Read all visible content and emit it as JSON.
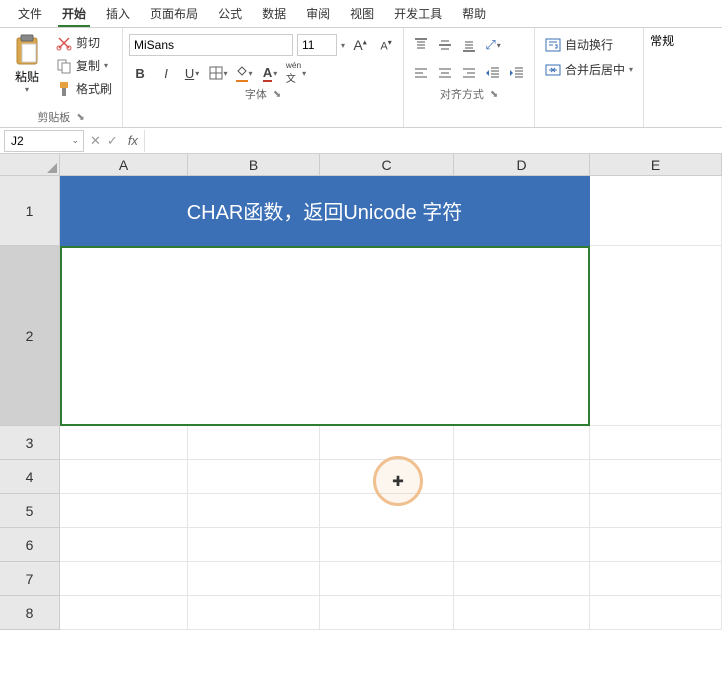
{
  "menu": {
    "items": [
      "文件",
      "开始",
      "插入",
      "页面布局",
      "公式",
      "数据",
      "审阅",
      "视图",
      "开发工具",
      "帮助"
    ],
    "active_index": 1
  },
  "ribbon": {
    "clipboard": {
      "paste": "粘贴",
      "cut": "剪切",
      "copy": "复制",
      "format_painter": "格式刷",
      "group_label": "剪贴板"
    },
    "font": {
      "font_name": "MiSans",
      "font_size": "11",
      "group_label": "字体",
      "bold": "B",
      "italic": "I",
      "underline": "U",
      "wen": "文"
    },
    "align": {
      "group_label": "对齐方式"
    },
    "merge": {
      "wrap_text": "自动换行",
      "merge_center": "合并后居中"
    },
    "right": {
      "label": "常规"
    }
  },
  "namebox": {
    "value": "J2"
  },
  "formula": {
    "value": ""
  },
  "columns": [
    "A",
    "B",
    "C",
    "D",
    "E"
  ],
  "row_numbers": [
    "1",
    "2",
    "3",
    "4",
    "5",
    "6",
    "7",
    "8"
  ],
  "cells": {
    "title": "CHAR函数，返回Unicode 字符"
  }
}
